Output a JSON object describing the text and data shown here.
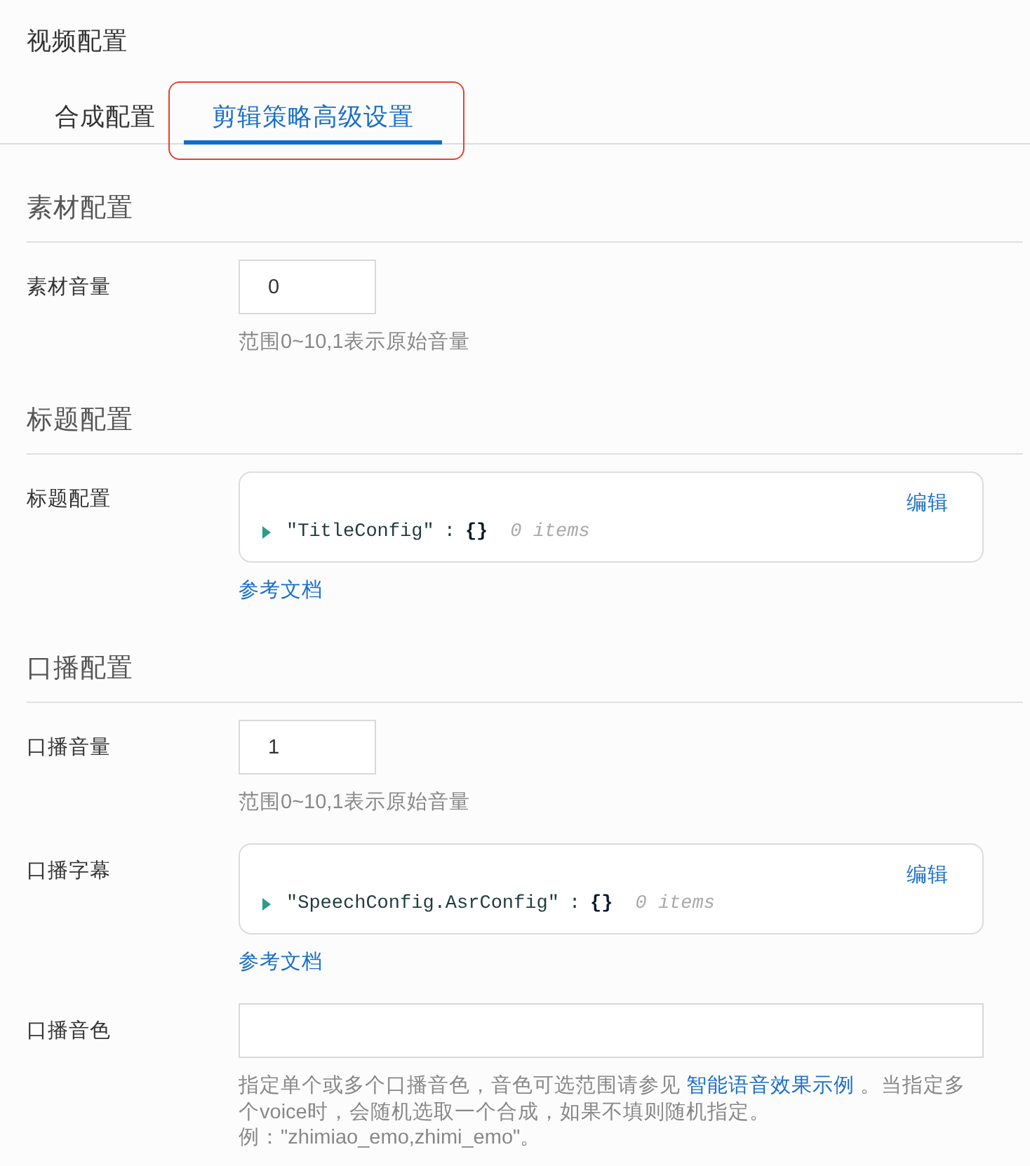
{
  "page": {
    "title": "视频配置"
  },
  "tabs": [
    {
      "label": "合成配置",
      "selected": false,
      "highlighted": false
    },
    {
      "label": "剪辑策略高级设置",
      "selected": true,
      "highlighted": true
    }
  ],
  "sections": [
    {
      "title": "素材配置",
      "fields": [
        {
          "kind": "number",
          "label": "素材音量",
          "value": "0",
          "help": "范围0~10,1表示原始音量"
        }
      ]
    },
    {
      "title": "标题配置",
      "fields": [
        {
          "kind": "json",
          "label": "标题配置",
          "action": "编辑",
          "expanded": false,
          "key": "\"TitleConfig\"",
          "separator": ":",
          "braces": "{}",
          "summary": "0 items",
          "link": "参考文档"
        }
      ]
    },
    {
      "title": "口播配置",
      "fields": [
        {
          "kind": "number",
          "label": "口播音量",
          "value": "1",
          "help": "范围0~10,1表示原始音量"
        },
        {
          "kind": "json",
          "label": "口播字幕",
          "action": "编辑",
          "expanded": false,
          "key": "\"SpeechConfig.AsrConfig\"",
          "separator": ":",
          "braces": "{}",
          "summary": "0 items",
          "link": "参考文档"
        },
        {
          "kind": "text",
          "label": "口播音色",
          "help": {
            "before": "指定单个或多个口播音色，音色可选范围请参见 ",
            "link": "智能语音效果示例",
            "after": " 。当指定多个voice时，会随机选取一个合成，如果不填则随机指定。"
          },
          "example": "例：\"zhimiao_emo,zhimi_emo\"。"
        }
      ]
    }
  ]
}
